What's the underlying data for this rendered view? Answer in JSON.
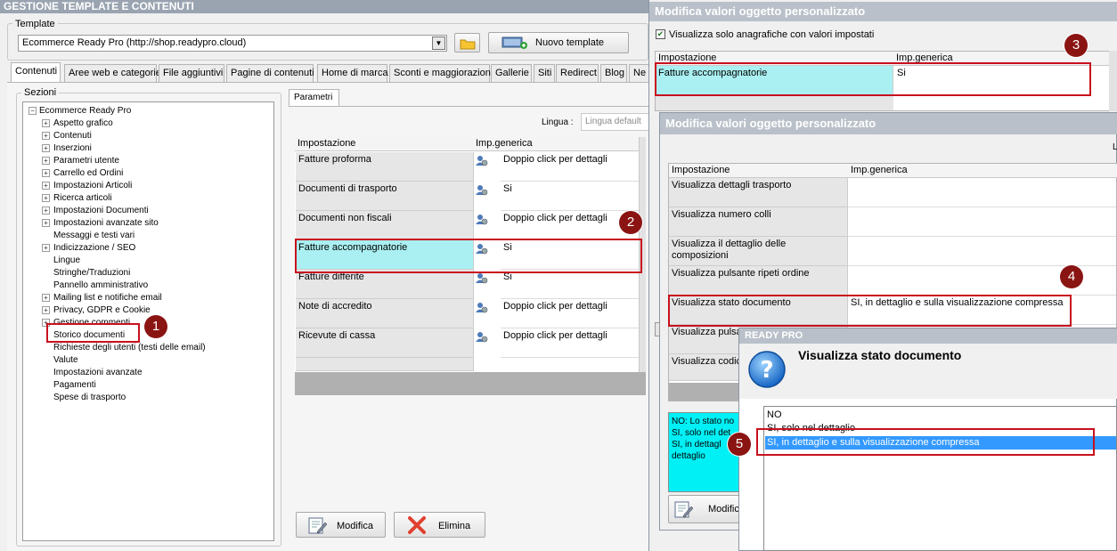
{
  "main": {
    "title": "GESTIONE TEMPLATE E CONTENUTI",
    "template_group_label": "Template",
    "template_value": "Ecommerce Ready Pro (http://shop.readypro.cloud)",
    "new_template_label": "Nuovo template",
    "tabs": [
      "Contenuti",
      "Aree web e categorie",
      "File aggiuntivi",
      "Pagine di contenuti",
      "Home di marca",
      "Sconti e maggiorazioni",
      "Gallerie",
      "Siti",
      "Redirect",
      "Blog",
      "Ne"
    ],
    "sections_label": "Sezioni",
    "tree": {
      "root": "Ecommerce Ready Pro",
      "items": [
        "Aspetto grafico",
        "Contenuti",
        "Inserzioni",
        "Parametri utente",
        "Carrello ed Ordini",
        "Impostazioni Articoli",
        "Ricerca articoli",
        "Impostazioni Documenti",
        "Impostazioni avanzate sito",
        "Messaggi e testi vari",
        "Indicizzazione / SEO",
        "Lingue",
        "Stringhe/Traduzioni",
        "Pannello amministrativo",
        "Mailing list e notifiche email",
        "Privacy, GDPR e Cookie",
        "Gestione commenti",
        "Storico documenti",
        "Richieste degli utenti (testi delle email)",
        "Valute",
        "Impostazioni avanzate",
        "Pagamenti",
        "Spese di trasporto"
      ]
    },
    "params_tab": "Parametri",
    "language_label": "Lingua :",
    "language_value": "Lingua default",
    "grid": {
      "headers": [
        "Impostazione",
        "Imp.generica"
      ],
      "rows": [
        {
          "name": "Fatture proforma",
          "value": "Doppio click per dettagli"
        },
        {
          "name": "Documenti di trasporto",
          "value": "Si"
        },
        {
          "name": "Documenti non fiscali",
          "value": "Doppio click per dettagli"
        },
        {
          "name": "Fatture accompagnatorie",
          "value": "Si"
        },
        {
          "name": "Fatture differite",
          "value": "Si"
        },
        {
          "name": "Note di accredito",
          "value": "Doppio click per dettagli"
        },
        {
          "name": "Ricevute di cassa",
          "value": "Doppio click per dettagli"
        }
      ]
    },
    "modify_label": "Modifica",
    "delete_label": "Elimina"
  },
  "dialog1": {
    "title": "Modifica valori oggetto personalizzato",
    "checkbox_label": "Visualizza solo anagrafiche con valori impostati",
    "headers": [
      "Impostazione",
      "Imp.generica"
    ],
    "row_name": "Fatture accompagnatorie",
    "row_value": "Si"
  },
  "dialog2": {
    "title": "Modifica valori oggetto personalizzato",
    "corner_letter": "L",
    "headers": [
      "Impostazione",
      "Imp.generica"
    ],
    "rows": [
      {
        "name": "Visualizza dettagli trasporto",
        "value": ""
      },
      {
        "name": "Visualizza numero colli",
        "value": ""
      },
      {
        "name": "Visualizza il dettaglio delle composizioni",
        "value": ""
      },
      {
        "name": "Visualizza pulsante ripeti ordine",
        "value": ""
      },
      {
        "name": "Visualizza stato documento",
        "value": "SI, in dettaglio e sulla visualizzazione compressa"
      },
      {
        "name": "Visualizza pulsan",
        "value": ""
      },
      {
        "name": "Visualizza codice documento",
        "value": ""
      }
    ],
    "desc_lines": [
      "NO: Lo stato no",
      "SI, solo nel det",
      "SI, in dettagl",
      "dettaglio"
    ],
    "modify_label": "Modific"
  },
  "dialog3": {
    "title": "READY PRO",
    "heading": "Visualizza stato documento",
    "options": [
      "NO",
      "SI, solo nel dettaglio",
      "SI, in dettaglio e sulla visualizzazione compressa"
    ],
    "selected_index": 2
  },
  "markers": [
    "1",
    "2",
    "3",
    "4",
    "5"
  ],
  "colors": {
    "highlight_row": "#aaf0f2",
    "callout_red": "#c8101e",
    "marker_bg": "#8a1412",
    "selection_blue": "#3399ff"
  }
}
